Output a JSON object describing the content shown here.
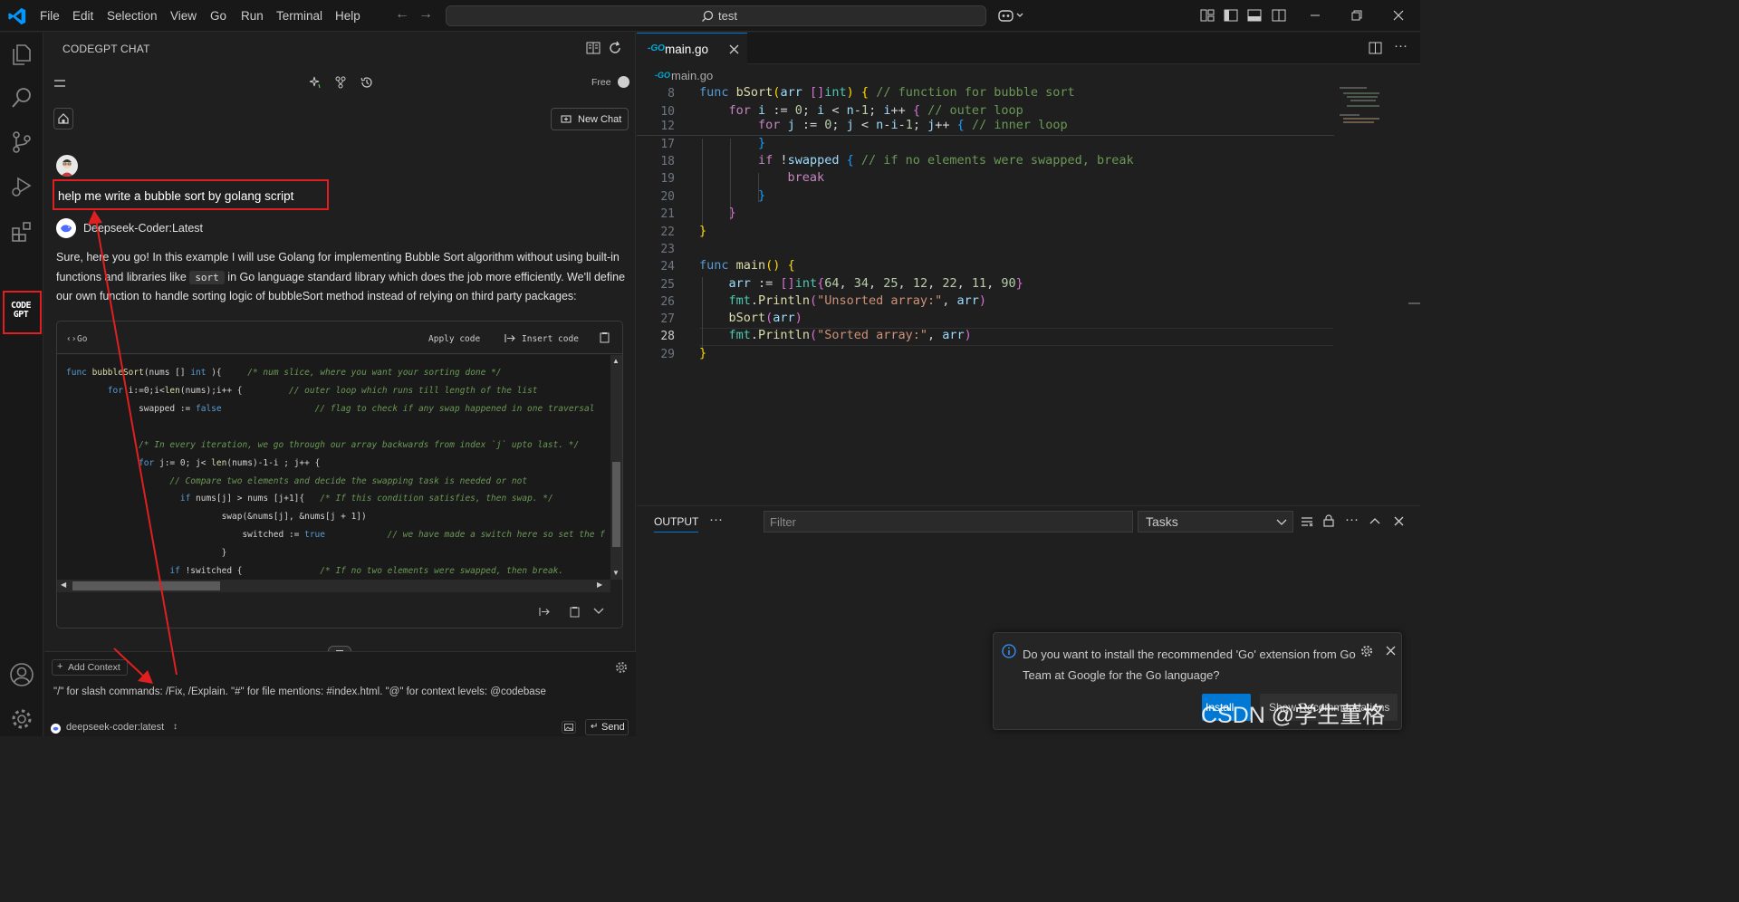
{
  "titlebar": {
    "menu": [
      "File",
      "Edit",
      "Selection",
      "View",
      "Go",
      "Run",
      "Terminal",
      "Help"
    ],
    "search_text": "test",
    "icons": [
      "vscode-logo-icon",
      "arrow-left-icon",
      "arrow-right-icon",
      "search-icon",
      "copilot-icon",
      "customize-layout-icon",
      "toggle-sidebar-icon",
      "toggle-panel-icon",
      "toggle-secondary-sidebar-icon",
      "minimize-icon",
      "restore-icon",
      "close-icon"
    ]
  },
  "activity_bar": {
    "items": [
      "explorer-icon",
      "search-icon",
      "source-control-icon",
      "run-debug-icon",
      "extensions-icon",
      "codegpt-icon",
      "accounts-icon",
      "manage-gear-icon"
    ],
    "codegpt_label_1": "CODE",
    "codegpt_label_2": "GPT"
  },
  "chat": {
    "panel_title": "CODEGPT CHAT",
    "plan": "Free",
    "new_chat": "New Chat",
    "user_prompt": "help me write a bubble sort by golang script",
    "assistant_name": "Deepseek-Coder:Latest",
    "answer_line1": "Sure, here you go! In this example I will use Golang for implementing Bubble Sort algorithm without using built-in",
    "answer_line2a": "functions and libraries like",
    "answer_code": "sort",
    "answer_line2b": "in Go language standard library which does the job more efficiently. We'll define",
    "answer_line3": "our own function to handle sorting logic of bubbleSort method instead of relying on third party packages:",
    "code_lang": "Go",
    "apply_code": "Apply code",
    "insert_code": "Insert code",
    "add_context": "Add Context",
    "input_hint": "\"/\" for slash commands: /Fix, /Explain. \"#\" for file mentions: #index.html. \"@\" for context levels: @codebase",
    "model": "deepseek-coder:latest",
    "send": "Send"
  },
  "editor": {
    "tab_label": "main.go",
    "breadcrumb": "main.go",
    "line_numbers": [
      "8",
      "10",
      "12",
      "17",
      "18",
      "19",
      "20",
      "21",
      "22",
      "23",
      "24",
      "25",
      "26",
      "27",
      "28",
      "29"
    ],
    "active_line": "28"
  },
  "bottom_panel": {
    "tab": "OUTPUT",
    "filter_placeholder": "Filter",
    "tasks_select": "Tasks"
  },
  "notification": {
    "message": "Do you want to install the recommended 'Go' extension from Go Team at Google for the Go language?",
    "install": "Install",
    "show_recommendations": "Show Recommendations"
  },
  "watermark": "CSDN @学生董格",
  "colors": {
    "accent": "#0078d4",
    "annotation_red": "#e02020",
    "keyword": "#569cd6",
    "comment": "#6a9955",
    "string": "#ce9178",
    "function": "#dcdcaa"
  }
}
